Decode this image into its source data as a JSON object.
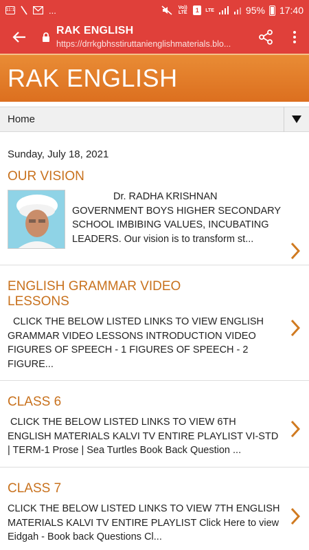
{
  "status_bar": {
    "left_icons": [
      "notification-icon",
      "mute-icon",
      "gmail-icon",
      "more-notifications-icon"
    ],
    "more_text": "...",
    "volte_label": "Vo)) LTE",
    "sim_label": "1",
    "lte_label": "LTE",
    "battery_percent": "95%",
    "time": "17:40"
  },
  "browser": {
    "title": "RAK ENGLISH",
    "url": "https://drrkgbhsstiruttanienglishmaterials.blo..."
  },
  "blog": {
    "title": "RAK ENGLISH"
  },
  "nav": {
    "label": "Home"
  },
  "date": "Sunday, July 18, 2021",
  "posts": [
    {
      "title": "OUR VISION",
      "snippet": "Dr. RADHA KRISHNAN GOVERNMENT BOYS HIGHER SECONDARY SCHOOL IMBIBING VALUES, INCUBATING LEADERS. Our vision is to transform st..."
    },
    {
      "title": "ENGLISH GRAMMAR VIDEO LESSONS",
      "snippet": "CLICK THE BELOW LISTED LINKS TO VIEW ENGLISH GRAMMAR VIDEO LESSONS INTRODUCTION VIDEO FIGURES OF SPEECH  - 1 FIGURES OF SPEECH  - 2 FIGURE..."
    },
    {
      "title": "CLASS 6",
      "snippet": "CLICK THE BELOW LISTED LINKS TO VIEW 6TH ENGLISH MATERIALS KALVI TV ENTIRE PLAYLIST VI-STD | TERM-1 Prose | Sea Turtles Book Back Question ..."
    },
    {
      "title": "CLASS 7",
      "snippet": "CLICK THE BELOW LISTED LINKS TO VIEW 7TH ENGLISH MATERIALS   KALVI TV ENTIRE PLAYLIST Click Here to view  Eidgah  -  Book back Questions Cl..."
    }
  ],
  "colors": {
    "toolbar": "#e0403a",
    "header_orange": "#e07a25",
    "post_title": "#c8711d"
  }
}
